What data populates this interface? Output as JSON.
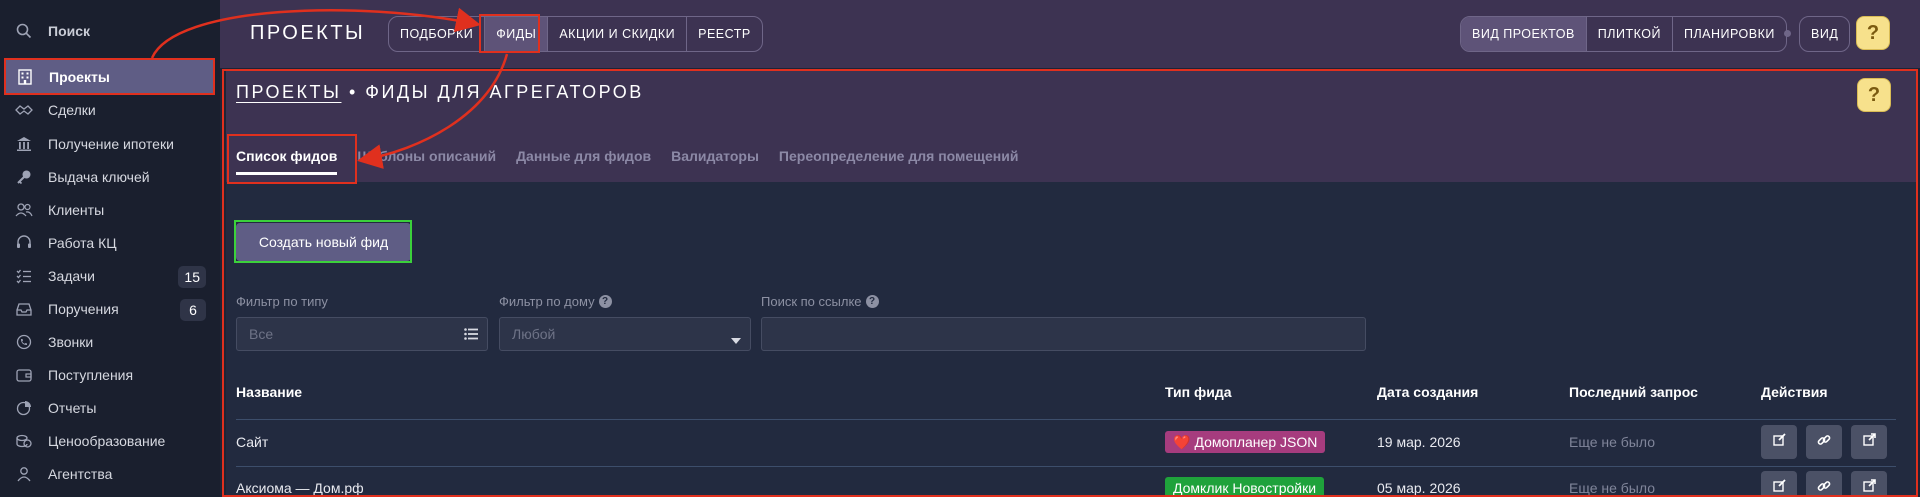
{
  "sidebar": {
    "search_label": "Поиск",
    "items": [
      {
        "label": "Проекты",
        "icon": "building-icon"
      },
      {
        "label": "Сделки",
        "icon": "handshake-icon"
      },
      {
        "label": "Получение ипотеки",
        "icon": "bank-icon"
      },
      {
        "label": "Выдача ключей",
        "icon": "key-icon"
      },
      {
        "label": "Клиенты",
        "icon": "users-icon"
      },
      {
        "label": "Работа КЦ",
        "icon": "headset-icon"
      },
      {
        "label": "Задачи",
        "icon": "tasks-icon",
        "badge": "15"
      },
      {
        "label": "Поручения",
        "icon": "inbox-icon",
        "badge": "6"
      },
      {
        "label": "Звонки",
        "icon": "phone-icon"
      },
      {
        "label": "Поступления",
        "icon": "wallet-icon"
      },
      {
        "label": "Отчеты",
        "icon": "pie-chart-icon"
      },
      {
        "label": "Ценообразование",
        "icon": "coins-icon"
      },
      {
        "label": "Агентства",
        "icon": "agent-icon"
      }
    ]
  },
  "topbar": {
    "brand": "ПРОЕКТЫ",
    "nav": [
      "ПОДБОРКИ",
      "ФИДЫ",
      "АКЦИИ И СКИДКИ",
      "РЕЕСТР"
    ],
    "views": [
      "ВИД ПРОЕКТОВ",
      "ПЛИТКОЙ",
      "ПЛАНИРОВКИ"
    ],
    "view_label": "ВИД",
    "help": "?"
  },
  "header": {
    "title_link": "ПРОЕКТЫ",
    "title_rest": " • ФИДЫ ДЛЯ АГРЕГАТОРОВ",
    "help": "?",
    "tabs": [
      "Список фидов",
      "Шаблоны описаний",
      "Данные для фидов",
      "Валидаторы",
      "Переопределение для помещений"
    ]
  },
  "main": {
    "create_button": "Создать новый фид",
    "filters": {
      "type_label": "Фильтр по типу",
      "type_value": "Все",
      "house_label": "Фильтр по дому",
      "house_value": "Любой",
      "link_label": "Поиск по ссылке",
      "help": "?"
    },
    "table": {
      "headers": [
        "Название",
        "Тип фида",
        "Дата создания",
        "Последний запрос",
        "Действия"
      ],
      "rows": [
        {
          "name": "Сайт",
          "type": "Домопланер JSON",
          "type_emoji": "❤️",
          "type_color": "#a63c7e",
          "created": "19 мар. 2026",
          "last": "Еще не было"
        },
        {
          "name": "Аксиома — Дом.рф",
          "type": "Домклик Новостройки",
          "type_emoji": "",
          "type_color": "#1fa23b",
          "created": "05 мар. 2026",
          "last": "Еще не было"
        }
      ]
    }
  },
  "colors": {
    "accent": "#5f5d85",
    "topbar": "#3d3352",
    "annotation_red": "#e0301e",
    "annotation_green": "#3bd13b"
  }
}
